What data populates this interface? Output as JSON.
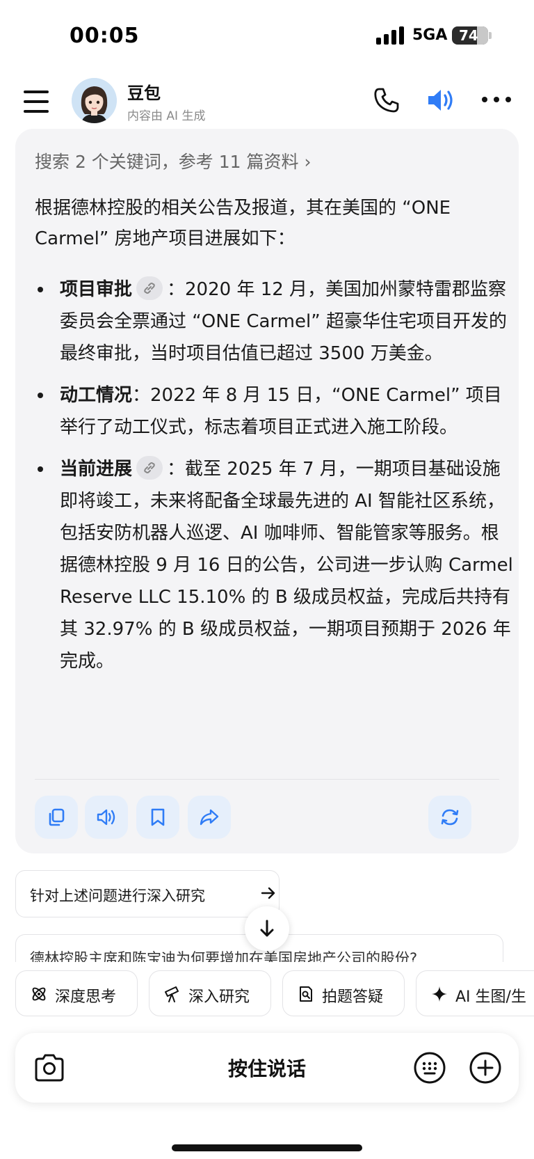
{
  "status_bar": {
    "time": "00:05",
    "network": "5GA",
    "battery": "74"
  },
  "header": {
    "title": "豆包",
    "subtitle": "内容由 AI 生成"
  },
  "answer": {
    "search_ref": "搜索 2 个关键词，参考 11 篇资料 ›",
    "intro": "根据德林控股的相关公告及报道，其在美国的 “ONE Carmel” 房地产项目进展如下：",
    "points": [
      {
        "title": "项目审批",
        "has_link": true,
        "text": "：2020 年 12 月，美国加州蒙特雷郡监察委员会全票通过 “ONE Carmel” 超豪华住宅项目开发的最终审批，当时项目估值已超过 3500 万美金。"
      },
      {
        "title": "动工情况",
        "has_link": false,
        "text": "：2022 年 8 月 15 日，“ONE Carmel” 项目举行了动工仪式，标志着项目正式进入施工阶段。"
      },
      {
        "title": "当前进展",
        "has_link": true,
        "text": "：截至 2025 年 7 月，一期项目基础设施即将竣工，未来将配备全球最先进的 AI 智能社区系统，包括安防机器人巡逻、AI 咖啡师、智能管家等服务。根据德林控股 9 月 16 日的公告，公司进一步认购 Carmel Reserve LLC 15.10% 的 B 级成员权益，完成后共持有其 32.97% 的 B 级成员权益，一期项目预期于 2026 年完成。"
      }
    ]
  },
  "suggestions": [
    "针对上述问题进行深入研究",
    "德林控股主席和陈宝迪为何要增加在美国房地产公司的股份?"
  ],
  "tools": [
    "深度思考",
    "深入研究",
    "拍题答疑",
    "AI 生图/生"
  ],
  "input": {
    "hold_to_talk": "按住说话"
  },
  "colors": {
    "accent": "#2f7cf6",
    "card_bg": "#f4f4f6",
    "action_bg": "#e6effb"
  }
}
